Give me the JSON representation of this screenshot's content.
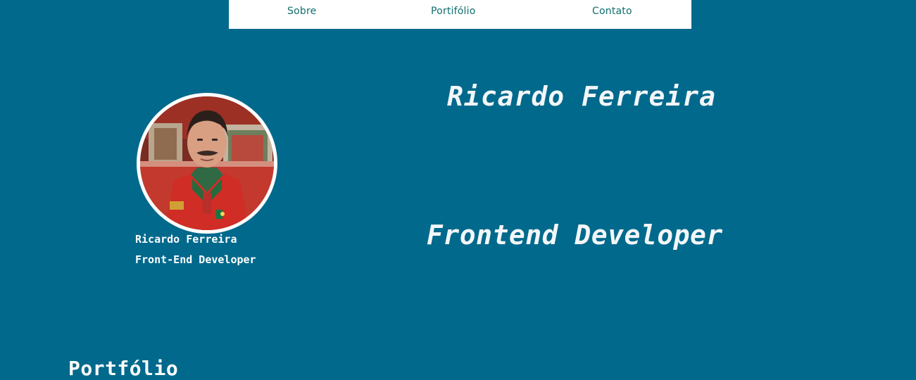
{
  "nav": {
    "items": [
      {
        "label": "Sobre"
      },
      {
        "label": "Portifólio"
      },
      {
        "label": "Contato"
      }
    ]
  },
  "hero": {
    "name": "Ricardo Ferreira",
    "role": "Frontend Developer"
  },
  "profile": {
    "name": "Ricardo Ferreira",
    "role": "Front-End Developer"
  },
  "section": {
    "title": "Portfólio"
  },
  "colors": {
    "background": "#00698c",
    "nav_background": "#ffffff",
    "nav_text": "#0f6e6e",
    "text": "#ffffff"
  }
}
